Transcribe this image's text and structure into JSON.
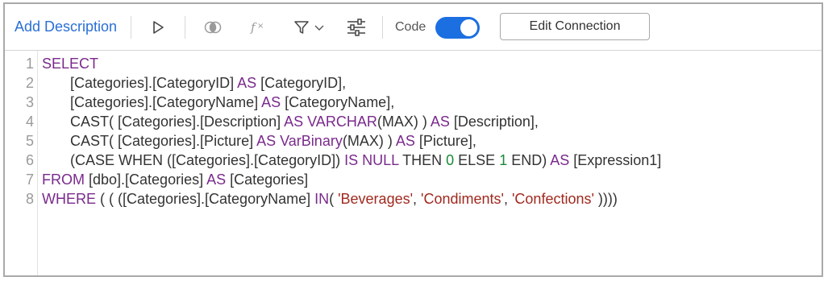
{
  "toolbar": {
    "add_description": "Add Description",
    "code_label": "Code",
    "code_toggle_on": true,
    "edit_connection": "Edit Connection",
    "icons": [
      "play-icon",
      "circles-icon",
      "fx-icon",
      "filter-icon",
      "chevron-down-icon",
      "sliders-icon"
    ]
  },
  "editor": {
    "line_numbers": [
      "1",
      "2",
      "3",
      "4",
      "5",
      "6",
      "7",
      "8"
    ],
    "lines": [
      [
        {
          "t": "SELECT",
          "c": "kw"
        }
      ],
      [
        {
          "t": "       [Categories].[CategoryID] ",
          "c": ""
        },
        {
          "t": "AS",
          "c": "kw"
        },
        {
          "t": " [CategoryID],",
          "c": ""
        }
      ],
      [
        {
          "t": "       [Categories].[CategoryName] ",
          "c": ""
        },
        {
          "t": "AS",
          "c": "kw"
        },
        {
          "t": " [CategoryName],",
          "c": ""
        }
      ],
      [
        {
          "t": "       CAST( [Categories].[Description] ",
          "c": ""
        },
        {
          "t": "AS",
          "c": "kw"
        },
        {
          "t": " ",
          "c": ""
        },
        {
          "t": "VARCHAR",
          "c": "kw"
        },
        {
          "t": "(MAX) ) ",
          "c": ""
        },
        {
          "t": "AS",
          "c": "kw"
        },
        {
          "t": " [Description],",
          "c": ""
        }
      ],
      [
        {
          "t": "       CAST( [Categories].[Picture] ",
          "c": ""
        },
        {
          "t": "AS",
          "c": "kw"
        },
        {
          "t": " ",
          "c": ""
        },
        {
          "t": "VarBinary",
          "c": "kw"
        },
        {
          "t": "(MAX) ) ",
          "c": ""
        },
        {
          "t": "AS",
          "c": "kw"
        },
        {
          "t": " [Picture],",
          "c": ""
        }
      ],
      [
        {
          "t": "       (CASE WHEN ([Categories].[CategoryID]) ",
          "c": ""
        },
        {
          "t": "IS NULL",
          "c": "kw"
        },
        {
          "t": " THEN ",
          "c": ""
        },
        {
          "t": "0",
          "c": "num"
        },
        {
          "t": " ELSE ",
          "c": ""
        },
        {
          "t": "1",
          "c": "num"
        },
        {
          "t": " END) ",
          "c": ""
        },
        {
          "t": "AS",
          "c": "kw"
        },
        {
          "t": " [Expression1]",
          "c": ""
        }
      ],
      [
        {
          "t": "FROM",
          "c": "kw"
        },
        {
          "t": " [dbo].[Categories] ",
          "c": ""
        },
        {
          "t": "AS",
          "c": "kw"
        },
        {
          "t": " [Categories]",
          "c": ""
        }
      ],
      [
        {
          "t": "WHERE",
          "c": "kw"
        },
        {
          "t": " ( ( ([Categories].[CategoryName] ",
          "c": ""
        },
        {
          "t": "IN",
          "c": "kw"
        },
        {
          "t": "( ",
          "c": ""
        },
        {
          "t": "'Beverages'",
          "c": "str"
        },
        {
          "t": ", ",
          "c": ""
        },
        {
          "t": "'Condiments'",
          "c": "str"
        },
        {
          "t": ", ",
          "c": ""
        },
        {
          "t": "'Confections'",
          "c": "str"
        },
        {
          "t": " ))))",
          "c": ""
        }
      ]
    ]
  },
  "colors": {
    "accent": "#1b6fe0",
    "link": "#2a6fd6",
    "keyword": "#7a2a8c",
    "string": "#a0291f",
    "number": "#1a8a3a"
  }
}
